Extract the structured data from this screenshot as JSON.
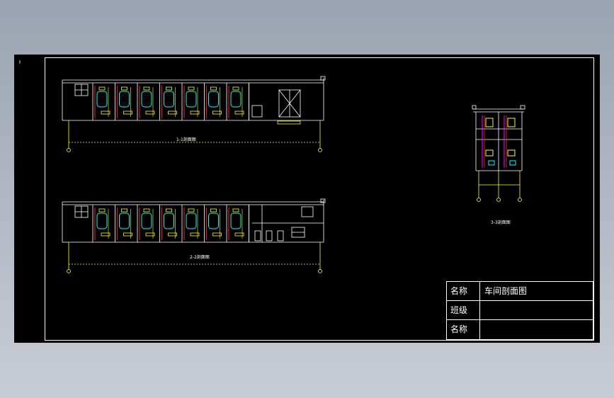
{
  "colors": {
    "background": "#000000",
    "line": "#ffffff",
    "yellow": "#ffff00",
    "cyan": "#00ffff",
    "magenta": "#ff00ff",
    "red": "#cc2222"
  },
  "sections": {
    "section_1_label": "1-1剖面图",
    "section_2_label": "2-2剖面图",
    "section_3_label": "3-3剖面图"
  },
  "title_block": {
    "rows": [
      {
        "key": "名称",
        "value": "车间剖面图"
      },
      {
        "key": "班级",
        "value": ""
      },
      {
        "key": "名称",
        "value": ""
      }
    ]
  }
}
